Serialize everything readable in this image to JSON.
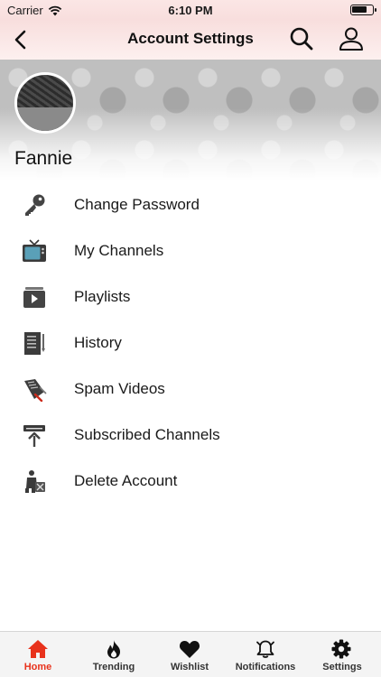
{
  "status_bar": {
    "carrier": "Carrier",
    "time": "6:10 PM"
  },
  "nav": {
    "title": "Account Settings",
    "back_icon": "chevron-left-icon",
    "search_icon": "search-icon",
    "user_icon": "user-icon"
  },
  "profile": {
    "name": "Fannie"
  },
  "menu": [
    {
      "label": "Change Password",
      "icon": "key-icon"
    },
    {
      "label": "My Channels",
      "icon": "tv-icon"
    },
    {
      "label": "Playlists",
      "icon": "playlist-icon"
    },
    {
      "label": "History",
      "icon": "history-icon"
    },
    {
      "label": "Spam Videos",
      "icon": "spam-icon"
    },
    {
      "label": "Subscribed Channels",
      "icon": "subscribe-icon"
    },
    {
      "label": "Delete Account",
      "icon": "delete-account-icon"
    }
  ],
  "tabs": [
    {
      "label": "Home",
      "icon": "home-icon",
      "active": true
    },
    {
      "label": "Trending",
      "icon": "flame-icon"
    },
    {
      "label": "Wishlist",
      "icon": "heart-icon"
    },
    {
      "label": "Notifications",
      "icon": "bell-icon"
    },
    {
      "label": "Settings",
      "icon": "gear-icon"
    }
  ],
  "colors": {
    "accent": "#e8321c",
    "header_tint": "#f8dedd",
    "tab_bar": "#f4f4f4"
  }
}
